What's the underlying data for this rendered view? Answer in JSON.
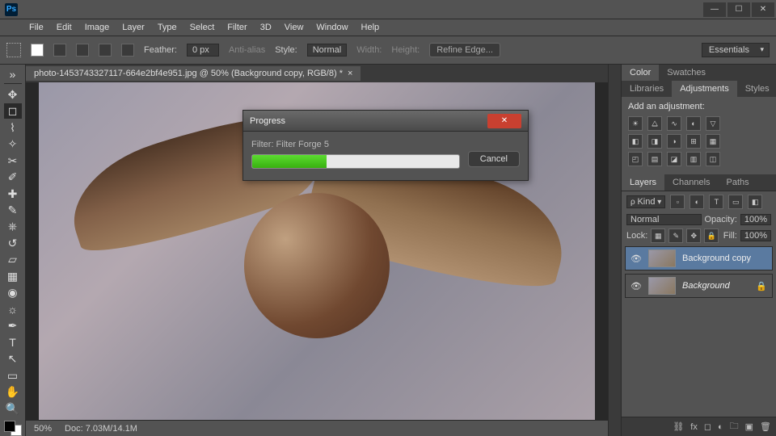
{
  "app": {
    "logo": "Ps"
  },
  "window": {
    "min": "—",
    "max": "☐",
    "close": "✕"
  },
  "menu": [
    "File",
    "Edit",
    "Image",
    "Layer",
    "Type",
    "Select",
    "Filter",
    "3D",
    "View",
    "Window",
    "Help"
  ],
  "optbar": {
    "feather_label": "Feather:",
    "feather_value": "0 px",
    "antialias": "Anti-alias",
    "style_label": "Style:",
    "style_value": "Normal",
    "width_label": "Width:",
    "height_label": "Height:",
    "refine": "Refine Edge...",
    "workspace": "Essentials"
  },
  "doc": {
    "tab": "photo-1453743327117-664e2bf4e951.jpg @ 50% (Background copy, RGB/8) *",
    "tab_close": "×"
  },
  "status": {
    "zoom": "50%",
    "doc": "Doc: 7.03M/14.1M"
  },
  "dialog": {
    "title": "Progress",
    "filter": "Filter: Filter Forge 5",
    "cancel": "Cancel",
    "progress_pct": 36
  },
  "panels": {
    "color_tabs": [
      "Color",
      "Swatches"
    ],
    "adj_tabs": [
      "Libraries",
      "Adjustments",
      "Styles"
    ],
    "adj_label": "Add an adjustment:",
    "layers_tabs": [
      "Layers",
      "Channels",
      "Paths"
    ],
    "kind_label": "Kind",
    "blend_mode": "Normal",
    "opacity_label": "Opacity:",
    "opacity_value": "100%",
    "lock_label": "Lock:",
    "fill_label": "Fill:",
    "fill_value": "100%",
    "layers": [
      {
        "name": "Background copy",
        "locked": false,
        "selected": true
      },
      {
        "name": "Background",
        "locked": true,
        "selected": false
      }
    ]
  },
  "tools": [
    "move",
    "marquee",
    "lasso",
    "wand",
    "crop",
    "eyedrop",
    "heal",
    "brush",
    "stamp",
    "history",
    "eraser",
    "gradient",
    "blur",
    "dodge",
    "pen",
    "type",
    "path",
    "shape",
    "hand",
    "zoom"
  ]
}
